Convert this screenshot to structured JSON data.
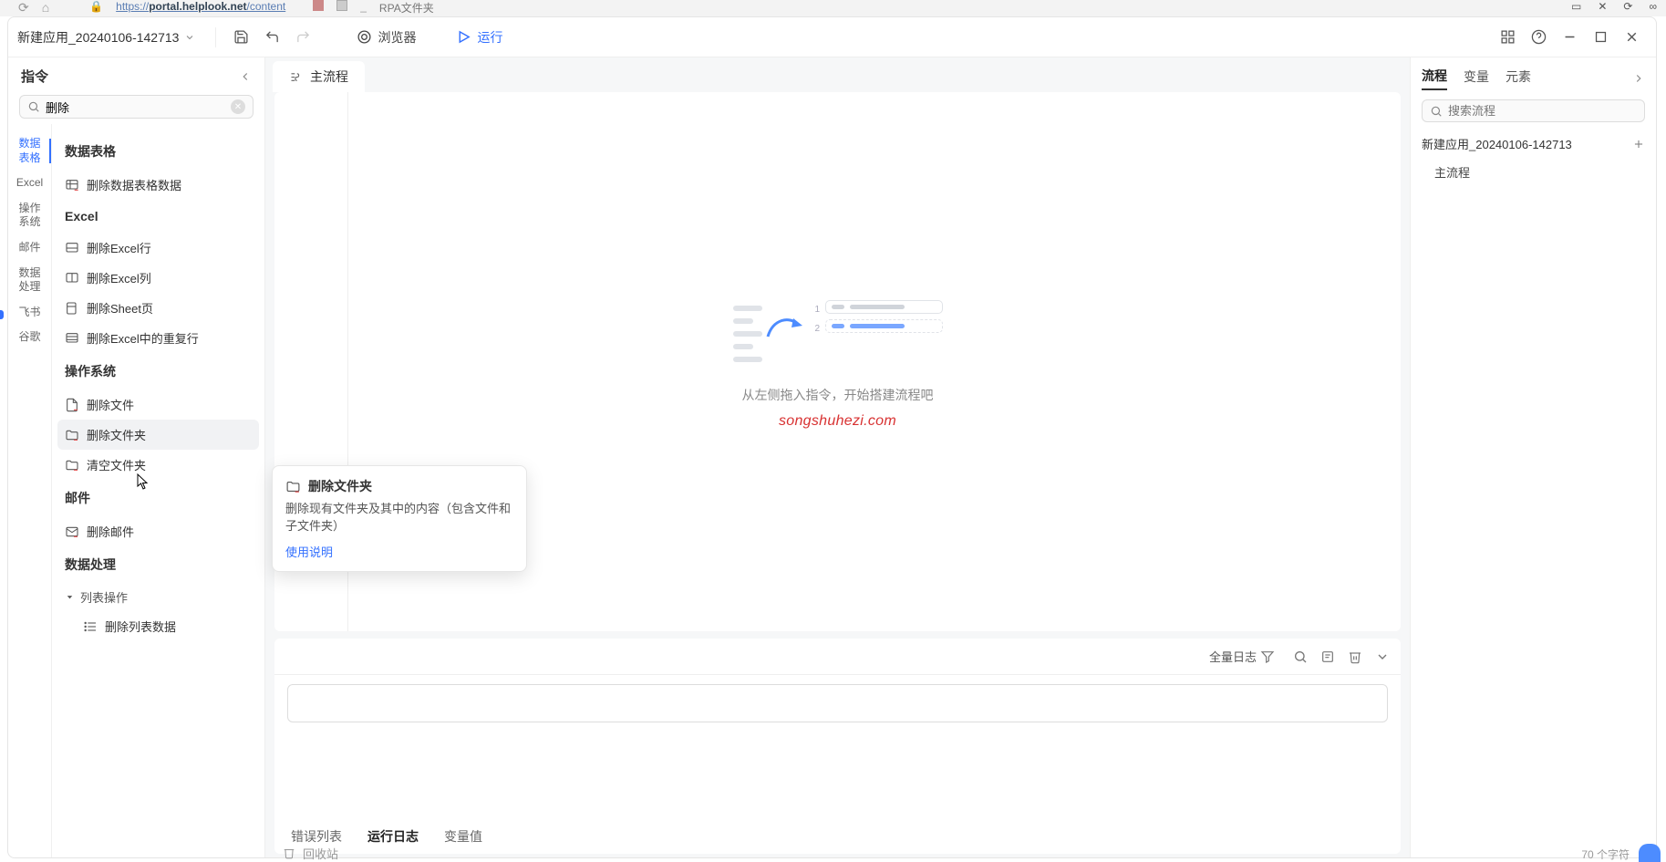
{
  "behind": {
    "url_left": "https://",
    "url_mid": "portal.helplook.net",
    "url_right": "/content",
    "tab_hint": "RPA文件夹"
  },
  "app": {
    "title": "新建应用_20240106-142713"
  },
  "toolbar": {
    "browser": "浏览器",
    "run": "运行"
  },
  "left": {
    "header": "指令",
    "search_value": "删除",
    "categories": [
      "数据表格",
      "Excel",
      "操作系统",
      "邮件",
      "数据处理",
      "飞书",
      "谷歌"
    ],
    "groups": {
      "data_table": {
        "title": "数据表格",
        "items": [
          "删除数据表格数据"
        ]
      },
      "excel": {
        "title": "Excel",
        "items": [
          "删除Excel行",
          "删除Excel列",
          "删除Sheet页",
          "删除Excel中的重复行"
        ]
      },
      "os": {
        "title": "操作系统",
        "items": [
          "删除文件",
          "删除文件夹",
          "清空文件夹"
        ]
      },
      "mail": {
        "title": "邮件",
        "items": [
          "删除邮件"
        ]
      },
      "data_proc": {
        "title": "数据处理",
        "sub": "列表操作",
        "items": [
          "删除列表数据"
        ]
      }
    }
  },
  "tab": {
    "main": "主流程"
  },
  "empty": {
    "hint": "从左侧拖入指令，开始搭建流程吧",
    "watermark": "songshuhezi.com"
  },
  "log": {
    "filter_label": "全量日志",
    "tabs": [
      "错误列表",
      "运行日志",
      "变量值"
    ]
  },
  "right": {
    "tabs": [
      "流程",
      "变量",
      "元素"
    ],
    "search_placeholder": "搜索流程",
    "app_name": "新建应用_20240106-142713",
    "flow_name": "主流程"
  },
  "tooltip": {
    "title": "删除文件夹",
    "desc": "删除现有文件夹及其中的内容（包含文件和子文件夹）",
    "link": "使用说明"
  },
  "footer": {
    "recycle": "回收站",
    "char_count": "70 个字符"
  }
}
